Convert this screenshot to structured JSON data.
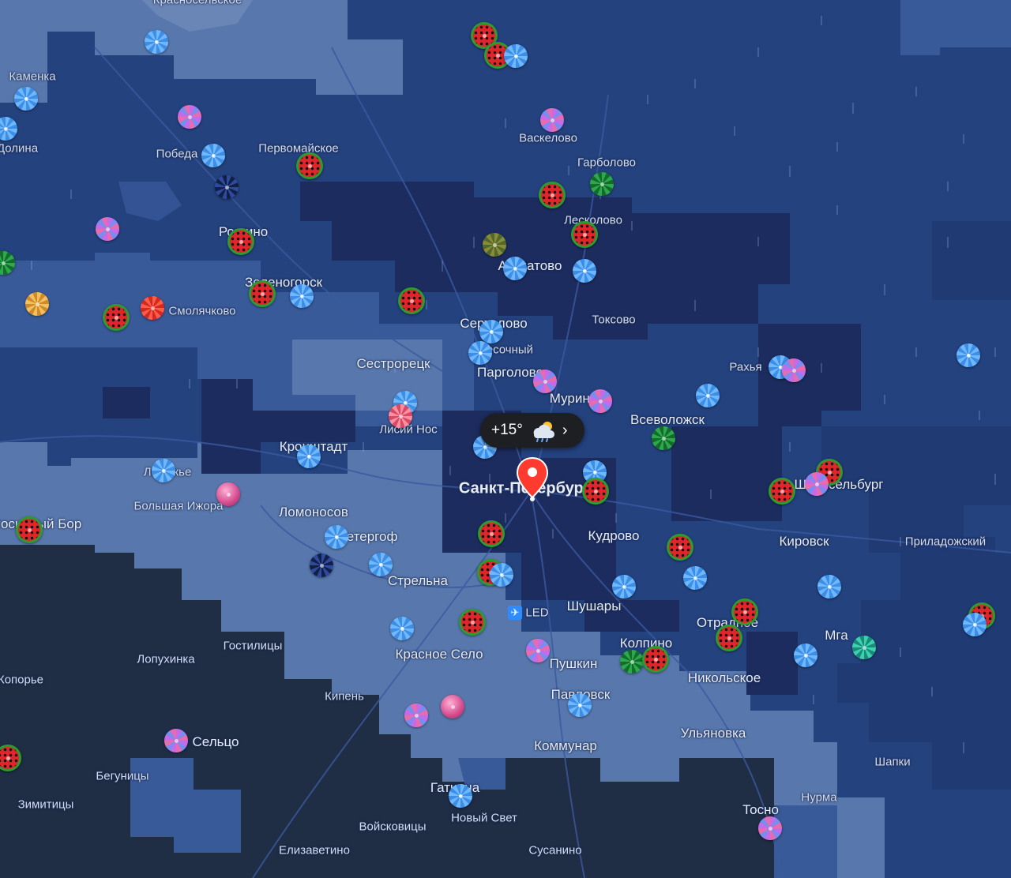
{
  "map": {
    "palette": {
      "background": "#1c2d55",
      "heavy_rain": "#1c2c5e",
      "rain": "#24427e",
      "light_rain": "#395a99",
      "drizzle": "#5878ad",
      "clear": "#1f2d45"
    }
  },
  "weather": {
    "temperature": "+15°",
    "icon": "cloud-rain-sun-icon",
    "chevron": "›"
  },
  "cities": [
    {
      "name": "Красносельское"
    },
    {
      "name": "Каменка"
    },
    {
      "name": "Долина"
    },
    {
      "name": "Победа"
    },
    {
      "name": "Первомайское"
    },
    {
      "name": "Васкелово"
    },
    {
      "name": "Гарболово"
    },
    {
      "name": "Лесколово"
    },
    {
      "name": "Рощино"
    },
    {
      "name": "Агалатово"
    },
    {
      "name": "Зеленогорск"
    },
    {
      "name": "Смолячково"
    },
    {
      "name": "Токсово"
    },
    {
      "name": "Сертолово"
    },
    {
      "name": "Песочный"
    },
    {
      "name": "Сестрорецк"
    },
    {
      "name": "Парголово"
    },
    {
      "name": "Рахья"
    },
    {
      "name": "Мурино"
    },
    {
      "name": "Всеволожск"
    },
    {
      "name": "Лисий Нос"
    },
    {
      "name": "Кронштадт"
    },
    {
      "name": "Лебяжье"
    },
    {
      "name": "Санкт-Петербург"
    },
    {
      "name": "Шлиссельбург"
    },
    {
      "name": "Большая Ижора"
    },
    {
      "name": "Сосновый Бор"
    },
    {
      "name": "Ломоносов"
    },
    {
      "name": "Петергоф"
    },
    {
      "name": "Кудрово"
    },
    {
      "name": "Кировск"
    },
    {
      "name": "Приладожский"
    },
    {
      "name": "Стрельна"
    },
    {
      "name": "LED"
    },
    {
      "name": "Шушары"
    },
    {
      "name": "Гостилицы"
    },
    {
      "name": "Отрадное"
    },
    {
      "name": "Мга"
    },
    {
      "name": "Колпино"
    },
    {
      "name": "Лопухинка"
    },
    {
      "name": "Красное Село"
    },
    {
      "name": "Пушкин"
    },
    {
      "name": "Никольское"
    },
    {
      "name": "Копорье"
    },
    {
      "name": "Кипень"
    },
    {
      "name": "Павловск"
    },
    {
      "name": "Ульяновка"
    },
    {
      "name": "Сельцо"
    },
    {
      "name": "Коммунар"
    },
    {
      "name": "Шапки"
    },
    {
      "name": "Бегуницы"
    },
    {
      "name": "Гатчина"
    },
    {
      "name": "Нурма"
    },
    {
      "name": "Зимитицы"
    },
    {
      "name": "Новый Свет"
    },
    {
      "name": "Тосно"
    },
    {
      "name": "Войсковицы"
    },
    {
      "name": "Елизаветино"
    },
    {
      "name": "Сусанино"
    }
  ],
  "markers": [
    {
      "icon": "umbrella-icon"
    },
    {
      "icon": "watermelon-icon"
    },
    {
      "icon": "berry-umbrella-icon"
    },
    {
      "icon": "green-umbrella-icon"
    },
    {
      "icon": "red-umbrella-icon"
    },
    {
      "icon": "orange-umbrella-icon"
    },
    {
      "icon": "dark-umbrella-icon"
    },
    {
      "icon": "pink-crystal-icon"
    },
    {
      "icon": "teal-umbrella-icon"
    },
    {
      "icon": "olive-umbrella-icon"
    },
    {
      "icon": "pink-umbrella-icon"
    }
  ]
}
